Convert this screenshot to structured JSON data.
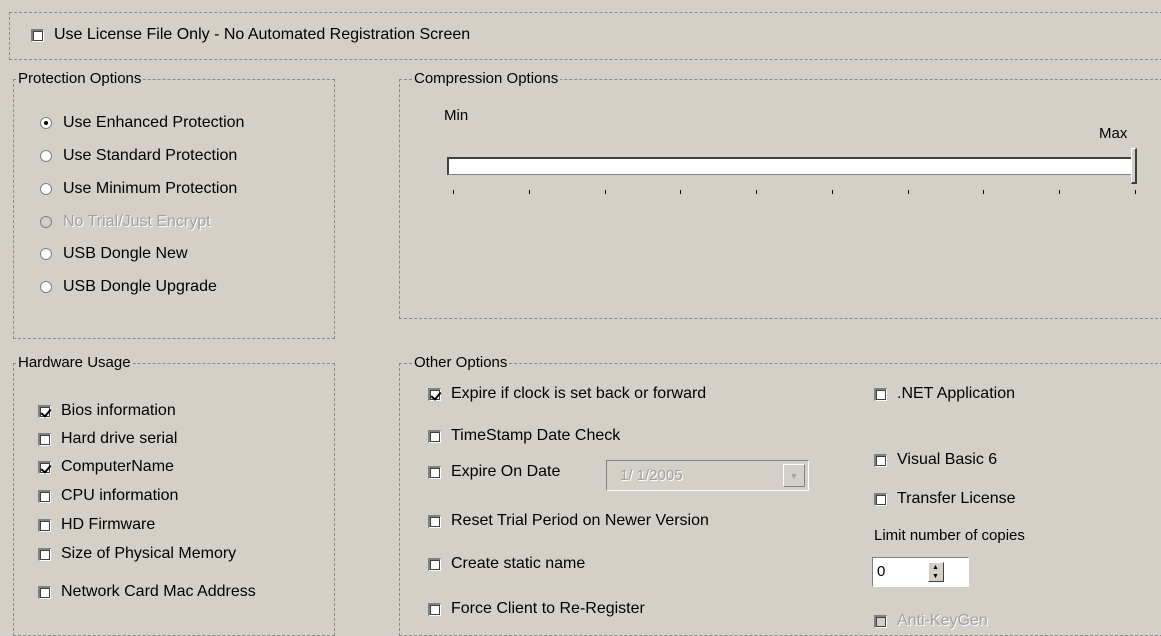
{
  "top": {
    "license_only": {
      "label": "Use License File Only - No Automated Registration Screen",
      "checked": false
    }
  },
  "protection": {
    "title": "Protection Options",
    "options": [
      {
        "label": "Use Enhanced Protection",
        "selected": true,
        "disabled": false
      },
      {
        "label": "Use Standard Protection",
        "selected": false,
        "disabled": false
      },
      {
        "label": "Use Minimum Protection",
        "selected": false,
        "disabled": false
      },
      {
        "label": "No Trial/Just Encrypt",
        "selected": false,
        "disabled": true
      },
      {
        "label": "USB Dongle New",
        "selected": false,
        "disabled": false
      },
      {
        "label": "USB Dongle Upgrade",
        "selected": false,
        "disabled": false
      }
    ]
  },
  "compression": {
    "title": "Compression Options",
    "min_label": "Min",
    "max_label": "Max",
    "level": 1.0,
    "tick_count": 10
  },
  "hardware": {
    "title": "Hardware Usage",
    "items": [
      {
        "label": "Bios information",
        "checked": true
      },
      {
        "label": "Hard drive serial",
        "checked": false
      },
      {
        "label": "ComputerName",
        "checked": true
      },
      {
        "label": "CPU information",
        "checked": false
      },
      {
        "label": "HD Firmware",
        "checked": false
      },
      {
        "label": "Size of Physical Memory",
        "checked": false
      },
      {
        "label": "Network Card Mac Address",
        "checked": false
      }
    ]
  },
  "other": {
    "title": "Other Options",
    "left": [
      {
        "label": "Expire if clock is set back or forward",
        "checked": true
      },
      {
        "label": "TimeStamp Date Check",
        "checked": false
      },
      {
        "label": "Expire On Date",
        "checked": false
      },
      {
        "label": "Reset Trial Period on Newer Version",
        "checked": false
      },
      {
        "label": "Create static name",
        "checked": false
      },
      {
        "label": "Force Client to Re-Register",
        "checked": false
      }
    ],
    "expire_date": {
      "value": "1/ 1/2005",
      "disabled": true
    },
    "right": [
      {
        "label": ".NET Application",
        "checked": false,
        "disabled": false
      },
      {
        "label": "Visual Basic 6",
        "checked": false,
        "disabled": false
      },
      {
        "label": "Transfer License",
        "checked": false,
        "disabled": false
      }
    ],
    "limit_copies": {
      "label": "Limit number of copies",
      "value": "0"
    },
    "antikeygen": {
      "label": "Anti-KeyGen",
      "checked": false,
      "disabled": true
    }
  }
}
